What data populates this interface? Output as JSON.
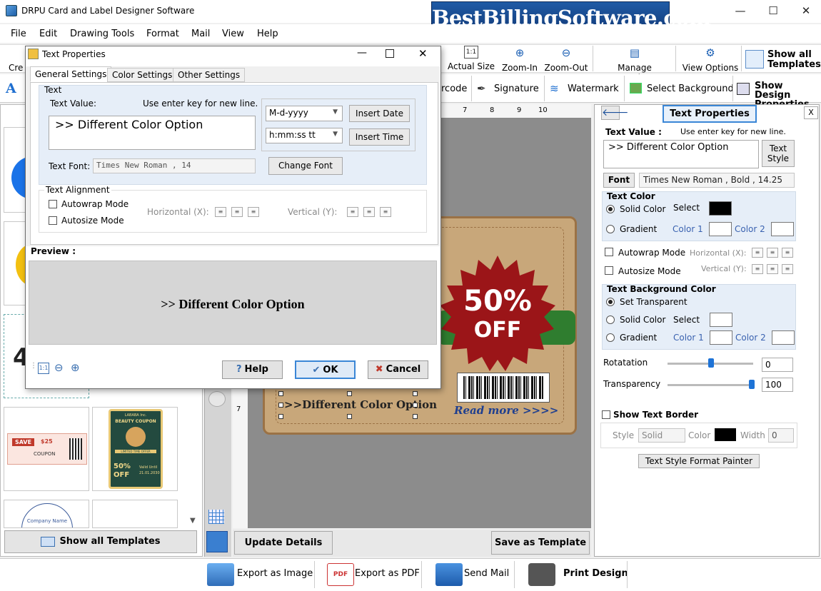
{
  "app": {
    "title": "DRPU Card and Label Designer Software",
    "brand": "BestBillingSoftware.com",
    "win_minimize": "—",
    "win_maximize": "☐",
    "win_close": "✕"
  },
  "menu": [
    "File",
    "Edit",
    "Drawing Tools",
    "Format",
    "Mail",
    "View",
    "Help"
  ],
  "toolbar1": {
    "create_partial": "Cre",
    "actual_size": "Actual Size",
    "zoom_in": "Zoom-In",
    "zoom_out": "Zoom-Out",
    "manage_template": "Manage Template",
    "view_options": "View Options",
    "show_all_templates_1": "Show all",
    "show_all_templates_2": "Templates"
  },
  "toolbar2": {
    "barcode_partial": "rcode",
    "signature": "Signature",
    "watermark": "Watermark",
    "select_background": "Select Background",
    "show_design_1": "Show Design",
    "show_design_2": "Properties"
  },
  "sidebar": {
    "show_all_templates": "Show all Templates",
    "coupon_save": "SAVE",
    "coupon_amount": "$25",
    "coupon_label": "COUPON",
    "beauty_brand": "LABABA Inc.",
    "beauty_title": "BEAUTY COUPON",
    "beauty_limited": "LIMITED TIME OFFER",
    "beauty_pct": "50%",
    "beauty_off": "OFF",
    "beauty_valid": "Valid Until",
    "beauty_date": "21.01.2030",
    "company_name": "Company Name",
    "partial_digit": "4"
  },
  "ruler": {
    "h_ticks": [
      "7",
      "8",
      "9",
      "10"
    ],
    "v_ticks": [
      "7"
    ]
  },
  "card": {
    "badge_pct": "50%",
    "badge_off": "OFF",
    "read_more": "Read more >>>>",
    "text": ">>Different Color Option"
  },
  "canvas_buttons": {
    "update_details": "Update Details",
    "save_as_template": "Save as Template"
  },
  "right_panel": {
    "title": "Text Properties",
    "back_arrow": "🡐",
    "close": "X",
    "text_value_label": "Text Value :",
    "hint": "Use enter key for new line.",
    "text_value": ">> Different Color Option",
    "text_style_1": "Text",
    "text_style_2": "Style",
    "font_btn": "Font",
    "font_value": "Times New Roman , Bold , 14.25",
    "text_color_heading": "Text Color",
    "solid_color": "Solid Color",
    "select": "Select",
    "gradient": "Gradient",
    "color1": "Color 1",
    "color2": "Color 2",
    "autowrap": "Autowrap Mode",
    "horizontal": "Horizontal (X):",
    "autosize": "Autosize Mode",
    "vertical": "Vertical (Y):",
    "bg_heading": "Text Background Color",
    "set_transparent": "Set Transparent",
    "rotation": "Rotatation",
    "rotation_value": "0",
    "transparency": "Transparency",
    "transparency_value": "100",
    "show_border": "Show Text Border",
    "style_label": "Style",
    "style_value": "Solid",
    "color_label": "Color",
    "width_label": "Width",
    "width_value": "0",
    "painter": "Text Style Format Painter",
    "text_color": "#000000",
    "rotation_level": 0,
    "transparency_level": 100
  },
  "footer": {
    "export_image": "Export as Image",
    "export_pdf": "Export as PDF",
    "send_mail": "Send Mail",
    "print_design": "Print Design",
    "pdf_tag": "PDF"
  },
  "dialog": {
    "title": "Text Properties",
    "tabs": [
      "General Settings",
      "Color Settings",
      "Other Settings"
    ],
    "text_group": "Text",
    "text_value_label": "Text Value:",
    "hint": "Use enter key for new line.",
    "text_value": ">> Different Color Option",
    "date_format": "M-d-yyyy",
    "insert_date": "Insert Date",
    "time_format": "h:mm:ss tt",
    "insert_time": "Insert Time",
    "text_font_label": "Text Font:",
    "text_font_value": "Times New Roman , 14",
    "change_font": "Change Font",
    "alignment_group": "Text Alignment",
    "autowrap": "Autowrap Mode",
    "horizontal": "Horizontal (X):",
    "vertical": "Vertical (Y):",
    "autosize": "Autosize Mode",
    "preview_label": "Preview :",
    "preview_text": ">> Different Color Option",
    "help": "Help",
    "ok": "OK",
    "cancel": "Cancel",
    "help_icon": "?",
    "ok_icon": "✔",
    "cancel_icon": "✖"
  }
}
